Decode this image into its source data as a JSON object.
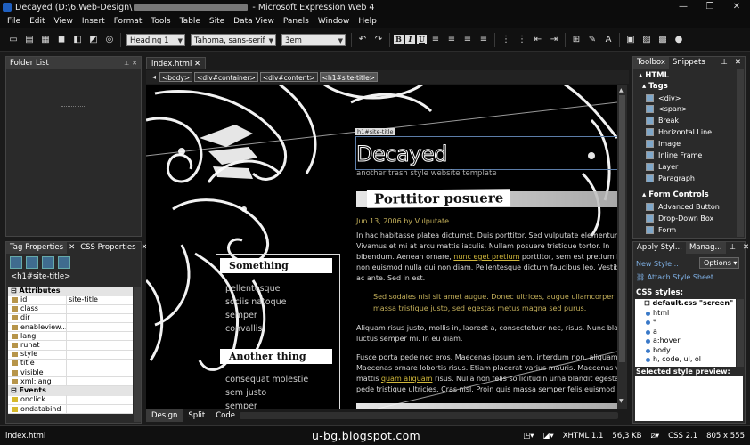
{
  "titlebar": {
    "title_prefix": "Decayed (D:\\6.Web-Design\\",
    "title_suffix": " - Microsoft Expression Web 4",
    "minimize": "—",
    "restore": "❐",
    "close": "✕"
  },
  "menu": [
    "File",
    "Edit",
    "View",
    "Insert",
    "Format",
    "Tools",
    "Table",
    "Site",
    "Data View",
    "Panels",
    "Window",
    "Help"
  ],
  "toolbar": {
    "style_value": "Heading 1",
    "font_value": "Tahoma, sans-serif",
    "size_value": "3em",
    "bold": "B",
    "italic": "I",
    "underline": "U"
  },
  "folder_list": {
    "title": "Folder List"
  },
  "tag_properties": {
    "tabs": [
      "Tag Properties",
      "CSS Properties"
    ],
    "current_tag": "<h1#site-title>",
    "groups": [
      {
        "name": "Attributes",
        "rows": [
          {
            "key": "id",
            "value": "site-title"
          },
          {
            "key": "class",
            "value": ""
          },
          {
            "key": "dir",
            "value": ""
          },
          {
            "key": "enableview...",
            "value": ""
          },
          {
            "key": "lang",
            "value": ""
          },
          {
            "key": "runat",
            "value": ""
          },
          {
            "key": "style",
            "value": ""
          },
          {
            "key": "title",
            "value": ""
          },
          {
            "key": "visible",
            "value": ""
          },
          {
            "key": "xml:lang",
            "value": ""
          }
        ]
      },
      {
        "name": "Events",
        "rows": [
          {
            "key": "onclick",
            "value": ""
          },
          {
            "key": "ondatabind",
            "value": ""
          }
        ]
      }
    ]
  },
  "document": {
    "tab": "index.html",
    "breadcrumb": [
      "<body>",
      "<div#container>",
      "<div#content>",
      "<h1#site-title>"
    ],
    "view_tabs": [
      "Design",
      "Split",
      "Code"
    ]
  },
  "page": {
    "h1_label": "h1#site-title",
    "site_title": "Decayed",
    "site_subtitle": "another trash style website template",
    "post_title": "Porttitor posuere",
    "post_date": "Jun 13, 2006 by Vulputate",
    "para1": [
      "In hac habitasse platea dictumst. Duis porttitor. Sed vulputate elementum n",
      "Vivamus et mi at arcu mattis iaculis. Nullam posuere tristique tortor. In",
      "non euismod nulla dui non diam. Pellentesque dictum faucibus leo. Vestibul",
      "ac ante. Sed in est."
    ],
    "para1_line3_before": "bibendum. Aenean ornare, ",
    "para1_link": "nunc eget pretium",
    "para1_line3_after": " porttitor, sem est pretium leo",
    "quote": [
      "Sed sodales nisl sit amet augue. Donec ultrices, augue ullamcorper",
      "massa tristique justo, sed egestas metus magna sed purus."
    ],
    "para2": [
      "Aliquam risus justo, mollis in, laoreet a, consectetuer nec, risus. Nunc bland",
      "luctus semper mi. In eu diam."
    ],
    "para3": [
      "Fusce porta pede nec eros. Maecenas ipsum sem, interdum non, aliquam vi",
      "Maecenas ornare lobortis risus. Etiam placerat varius mauris. Maecenas vi",
      "pede tristique ultricies. Cras nisl. Proin quis massa semper felis euismod ul"
    ],
    "para3_line3_before": "mattis ",
    "para3_link": "quam aliquam",
    "para3_line3_after": " risus. Nulla non felis sollicitudin urna blandit egestas.",
    "sidebar": {
      "heading1": "Something",
      "items1": [
        "pellentesque",
        "sociis natoque",
        "semper",
        "convallis"
      ],
      "heading2": "Another thing",
      "items2": [
        "consequat molestie",
        "sem justo",
        "semper"
      ]
    }
  },
  "toolbox": {
    "tabs": [
      "Toolbox",
      "Snippets"
    ],
    "group_html": "HTML",
    "group_tags": "Tags",
    "tags": [
      "<div>",
      "<span>",
      "Break",
      "Horizontal Line",
      "Image",
      "Inline Frame",
      "Layer",
      "Paragraph"
    ],
    "group_form": "Form Controls",
    "form": [
      "Advanced Button",
      "Drop-Down Box",
      "Form"
    ]
  },
  "styles": {
    "tabs": [
      "Apply Styl...",
      "Manag..."
    ],
    "new_style": "New Style...",
    "options": "Options",
    "attach": "Attach Style Sheet...",
    "css_styles_label": "CSS styles:",
    "sheet": "default.css \"screen\"",
    "rules": [
      "html",
      "*",
      "a",
      "a:hover",
      "body",
      "h, code, ul, ol"
    ],
    "preview_label": "Selected style preview:"
  },
  "statusbar": {
    "file": "index.html",
    "watermark": "u-bg.blogspot.com",
    "doctype": "XHTML 1.1",
    "filesize": "56,3 KB",
    "css": "CSS 2.1",
    "dimensions": "805 x 555"
  }
}
